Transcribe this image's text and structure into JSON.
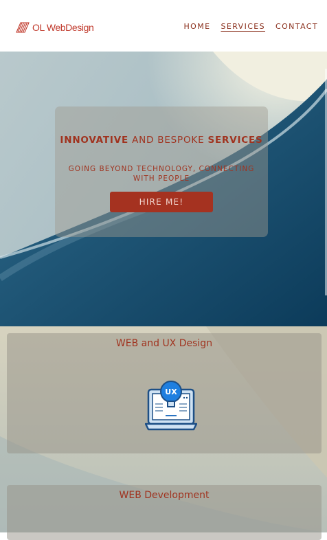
{
  "header": {
    "logo_text": "OL WebDesign",
    "nav": [
      {
        "label": "HOME",
        "active": false
      },
      {
        "label": "SERVICES",
        "active": true
      },
      {
        "label": "CONTACT",
        "active": false
      }
    ]
  },
  "hero": {
    "title_strong_1": "INNOVATIVE",
    "title_middle": " AND BESPOKE ",
    "title_strong_2": "SERVICES",
    "subtitle": "GOING BEYOND TECHNOLOGY, CONNECTING WITH PEOPLE",
    "cta_label": "HIRE ME!"
  },
  "services": [
    {
      "title": "WEB and UX Design",
      "icon": "ux-laptop-icon",
      "badge": "UX"
    },
    {
      "title": "WEB Development"
    }
  ],
  "colors": {
    "accent": "#a53220",
    "text_accent": "#a0331f",
    "nav_text": "#8a2f1c"
  }
}
